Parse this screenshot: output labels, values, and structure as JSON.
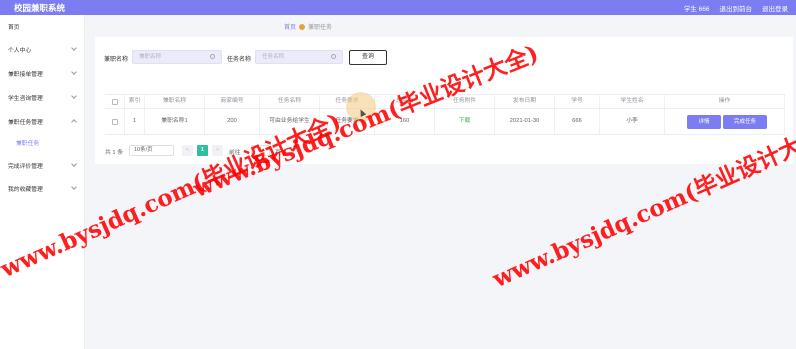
{
  "header": {
    "title": "校园兼职系统",
    "user": "学生 666",
    "back_to_front": "退出到前台",
    "logout": "退出登录"
  },
  "sidebar": {
    "items": [
      {
        "label": "首页",
        "has_children": false
      },
      {
        "label": "个人中心",
        "has_children": true
      },
      {
        "label": "兼职接单管理",
        "has_children": true
      },
      {
        "label": "学生咨询管理",
        "has_children": true
      },
      {
        "label": "兼职任务管理",
        "has_children": true
      },
      {
        "label": "兼职任务",
        "has_children": false,
        "sub": true
      },
      {
        "label": "完成评价管理",
        "has_children": true
      },
      {
        "label": "我的收藏管理",
        "has_children": true
      }
    ]
  },
  "breadcrumb": {
    "home": "首页",
    "current": "兼职任务"
  },
  "search": {
    "label1": "兼职名称",
    "placeholder1": "兼职名称",
    "label2": "任务名称",
    "placeholder2": "任务名称",
    "query_button": "查询"
  },
  "table": {
    "headers": [
      "索引",
      "兼职名称",
      "商家编号",
      "任务名称",
      "任务要求",
      "总监测",
      "任务附件",
      "发布日期",
      "学号",
      "学生姓名",
      "操作"
    ],
    "rows": [
      {
        "index": "1",
        "job_name": "兼职名称1",
        "merchant_id": "200",
        "task_name": "可由业务给学生",
        "task_req": "任务要求",
        "total": "160",
        "attachment": "下载",
        "date": "2021-01-30",
        "student_id": "666",
        "student_name": "小李",
        "action1": "详情",
        "action2": "完成任务"
      }
    ]
  },
  "pagination": {
    "total": "共 1 条",
    "page_size": "10条/页",
    "prev": "<",
    "current_page": "1",
    "next": ">",
    "goto_label": "前往",
    "goto_value": "1",
    "page_suffix": "页"
  },
  "watermark": {
    "text1": "www.bysjdq.com(毕业设计大全)",
    "text2": "www.bysjdq.com(毕业设计大全)",
    "text3": "www.bysjdq.com(毕业设计大全)"
  },
  "colors": {
    "accent": "#7b7df0",
    "page_active": "#2fbf9f",
    "watermark": "#ff0000"
  }
}
